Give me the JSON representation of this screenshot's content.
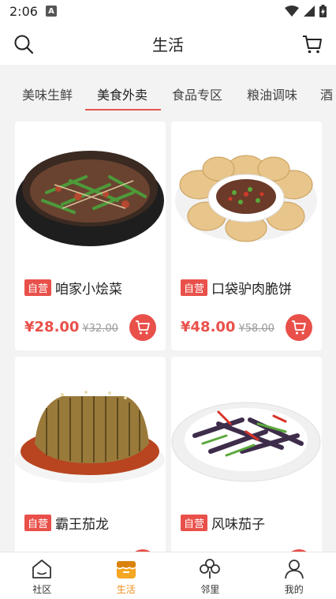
{
  "status_bar": {
    "time": "2:06",
    "notification_letter": "A"
  },
  "header": {
    "title": "生活"
  },
  "tabs": [
    {
      "label": "美味生鲜"
    },
    {
      "label": "美食外卖"
    },
    {
      "label": "食品专区"
    },
    {
      "label": "粮油调味"
    },
    {
      "label": "酒"
    }
  ],
  "active_tab_index": 1,
  "products": [
    {
      "badge": "自营",
      "name": "咱家小烩菜",
      "price": "¥28.00",
      "old_price": "¥32.00",
      "image": "stewed-vegetables-in-clay-pot"
    },
    {
      "badge": "自营",
      "name": "口袋驴肉脆饼",
      "price": "¥48.00",
      "old_price": "¥58.00",
      "image": "donkey-meat-crispy-pockets"
    },
    {
      "badge": "自营",
      "name": "霸王茄龙",
      "price": "",
      "old_price": "",
      "image": "eggplant-dragon-in-sauce"
    },
    {
      "badge": "自营",
      "name": "风味茄子",
      "price": "",
      "old_price": "",
      "image": "flavored-eggplant-stir-fry"
    }
  ],
  "bottom_nav": [
    {
      "label": "社区",
      "icon": "home-icon"
    },
    {
      "label": "生活",
      "icon": "store-icon"
    },
    {
      "label": "邻里",
      "icon": "clover-icon"
    },
    {
      "label": "我的",
      "icon": "user-icon"
    }
  ],
  "colors": {
    "accent": "#e9504a",
    "nav_active": "#f08c1a"
  }
}
